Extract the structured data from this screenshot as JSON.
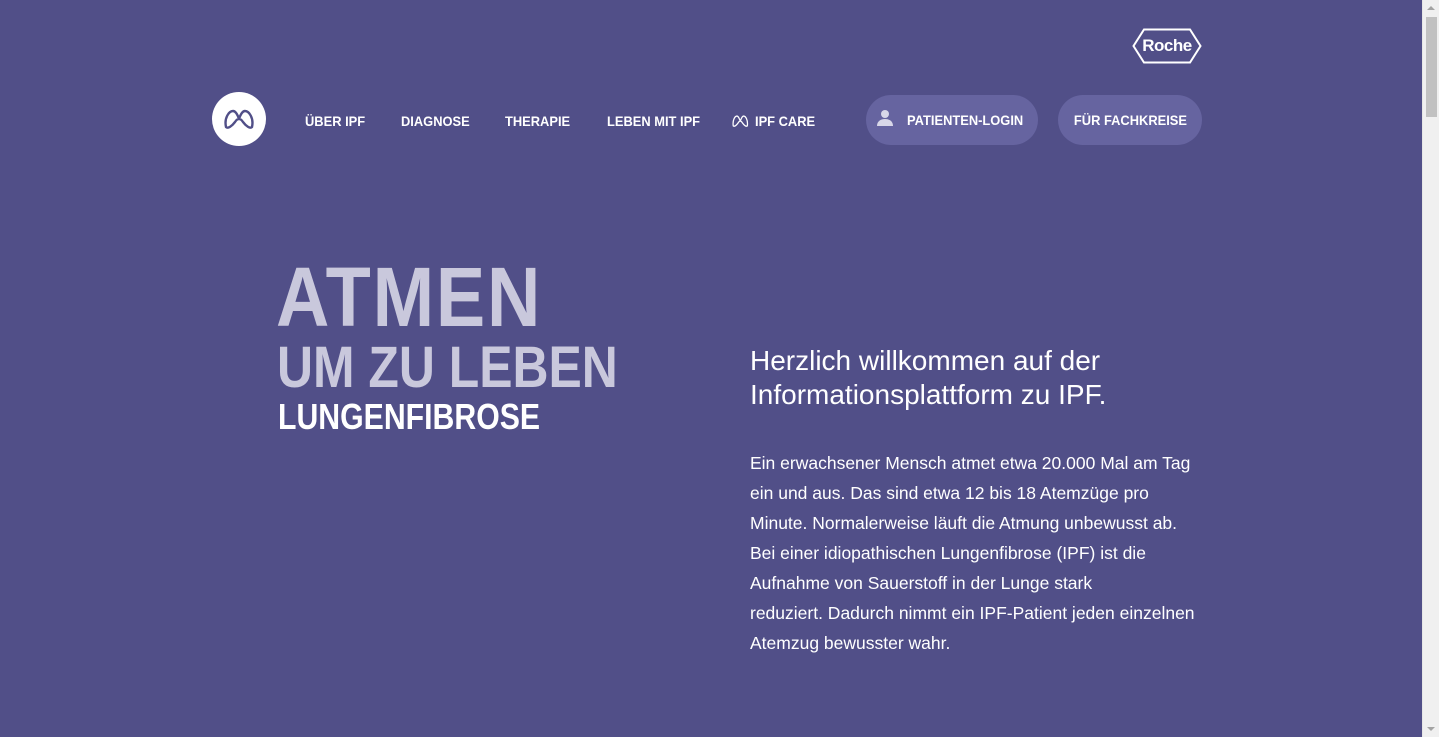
{
  "brand": {
    "roche_logo_text": "Roche",
    "site_logo_icon": "ipf-lungs-logo-icon"
  },
  "nav": {
    "items": [
      {
        "label": "ÜBER IPF"
      },
      {
        "label": "DIAGNOSE"
      },
      {
        "label": "THERAPIE"
      },
      {
        "label": "LEBEN MIT IPF"
      },
      {
        "label": "IPF CARE",
        "icon": "ipf-care-icon"
      }
    ],
    "login_label": "PATIENTEN-LOGIN",
    "login_icon": "user-icon",
    "professionals_label": "FÜR FACHKREISE"
  },
  "hero": {
    "title_line1": "ATMEN",
    "title_line2": "UM ZU LEBEN",
    "title_line3": "LUNGENFIBROSE",
    "welcome_line1": "Herzlich willkommen auf der",
    "welcome_line2": "Informationsplattform zu IPF.",
    "intro_lines": [
      "Ein erwachsener Mensch atmet etwa 20.000 Mal am Tag",
      "ein und aus. Das sind etwa 12 bis 18 Atemzüge pro",
      "Minute. Normalerweise läuft die Atmung unbewusst ab.",
      "Bei einer idiopathischen Lungenfibrose (IPF) ist die",
      "Aufnahme von Sauerstoff in der Lunge stark",
      "reduziert. Dadurch nimmt ein IPF-Patient jeden einzelnen",
      "Atemzug bewusster wahr."
    ]
  },
  "colors": {
    "background": "#514f88",
    "pill_button": "#6664a0",
    "hero_title_light": "#c9c8dc",
    "text": "#ffffff"
  }
}
